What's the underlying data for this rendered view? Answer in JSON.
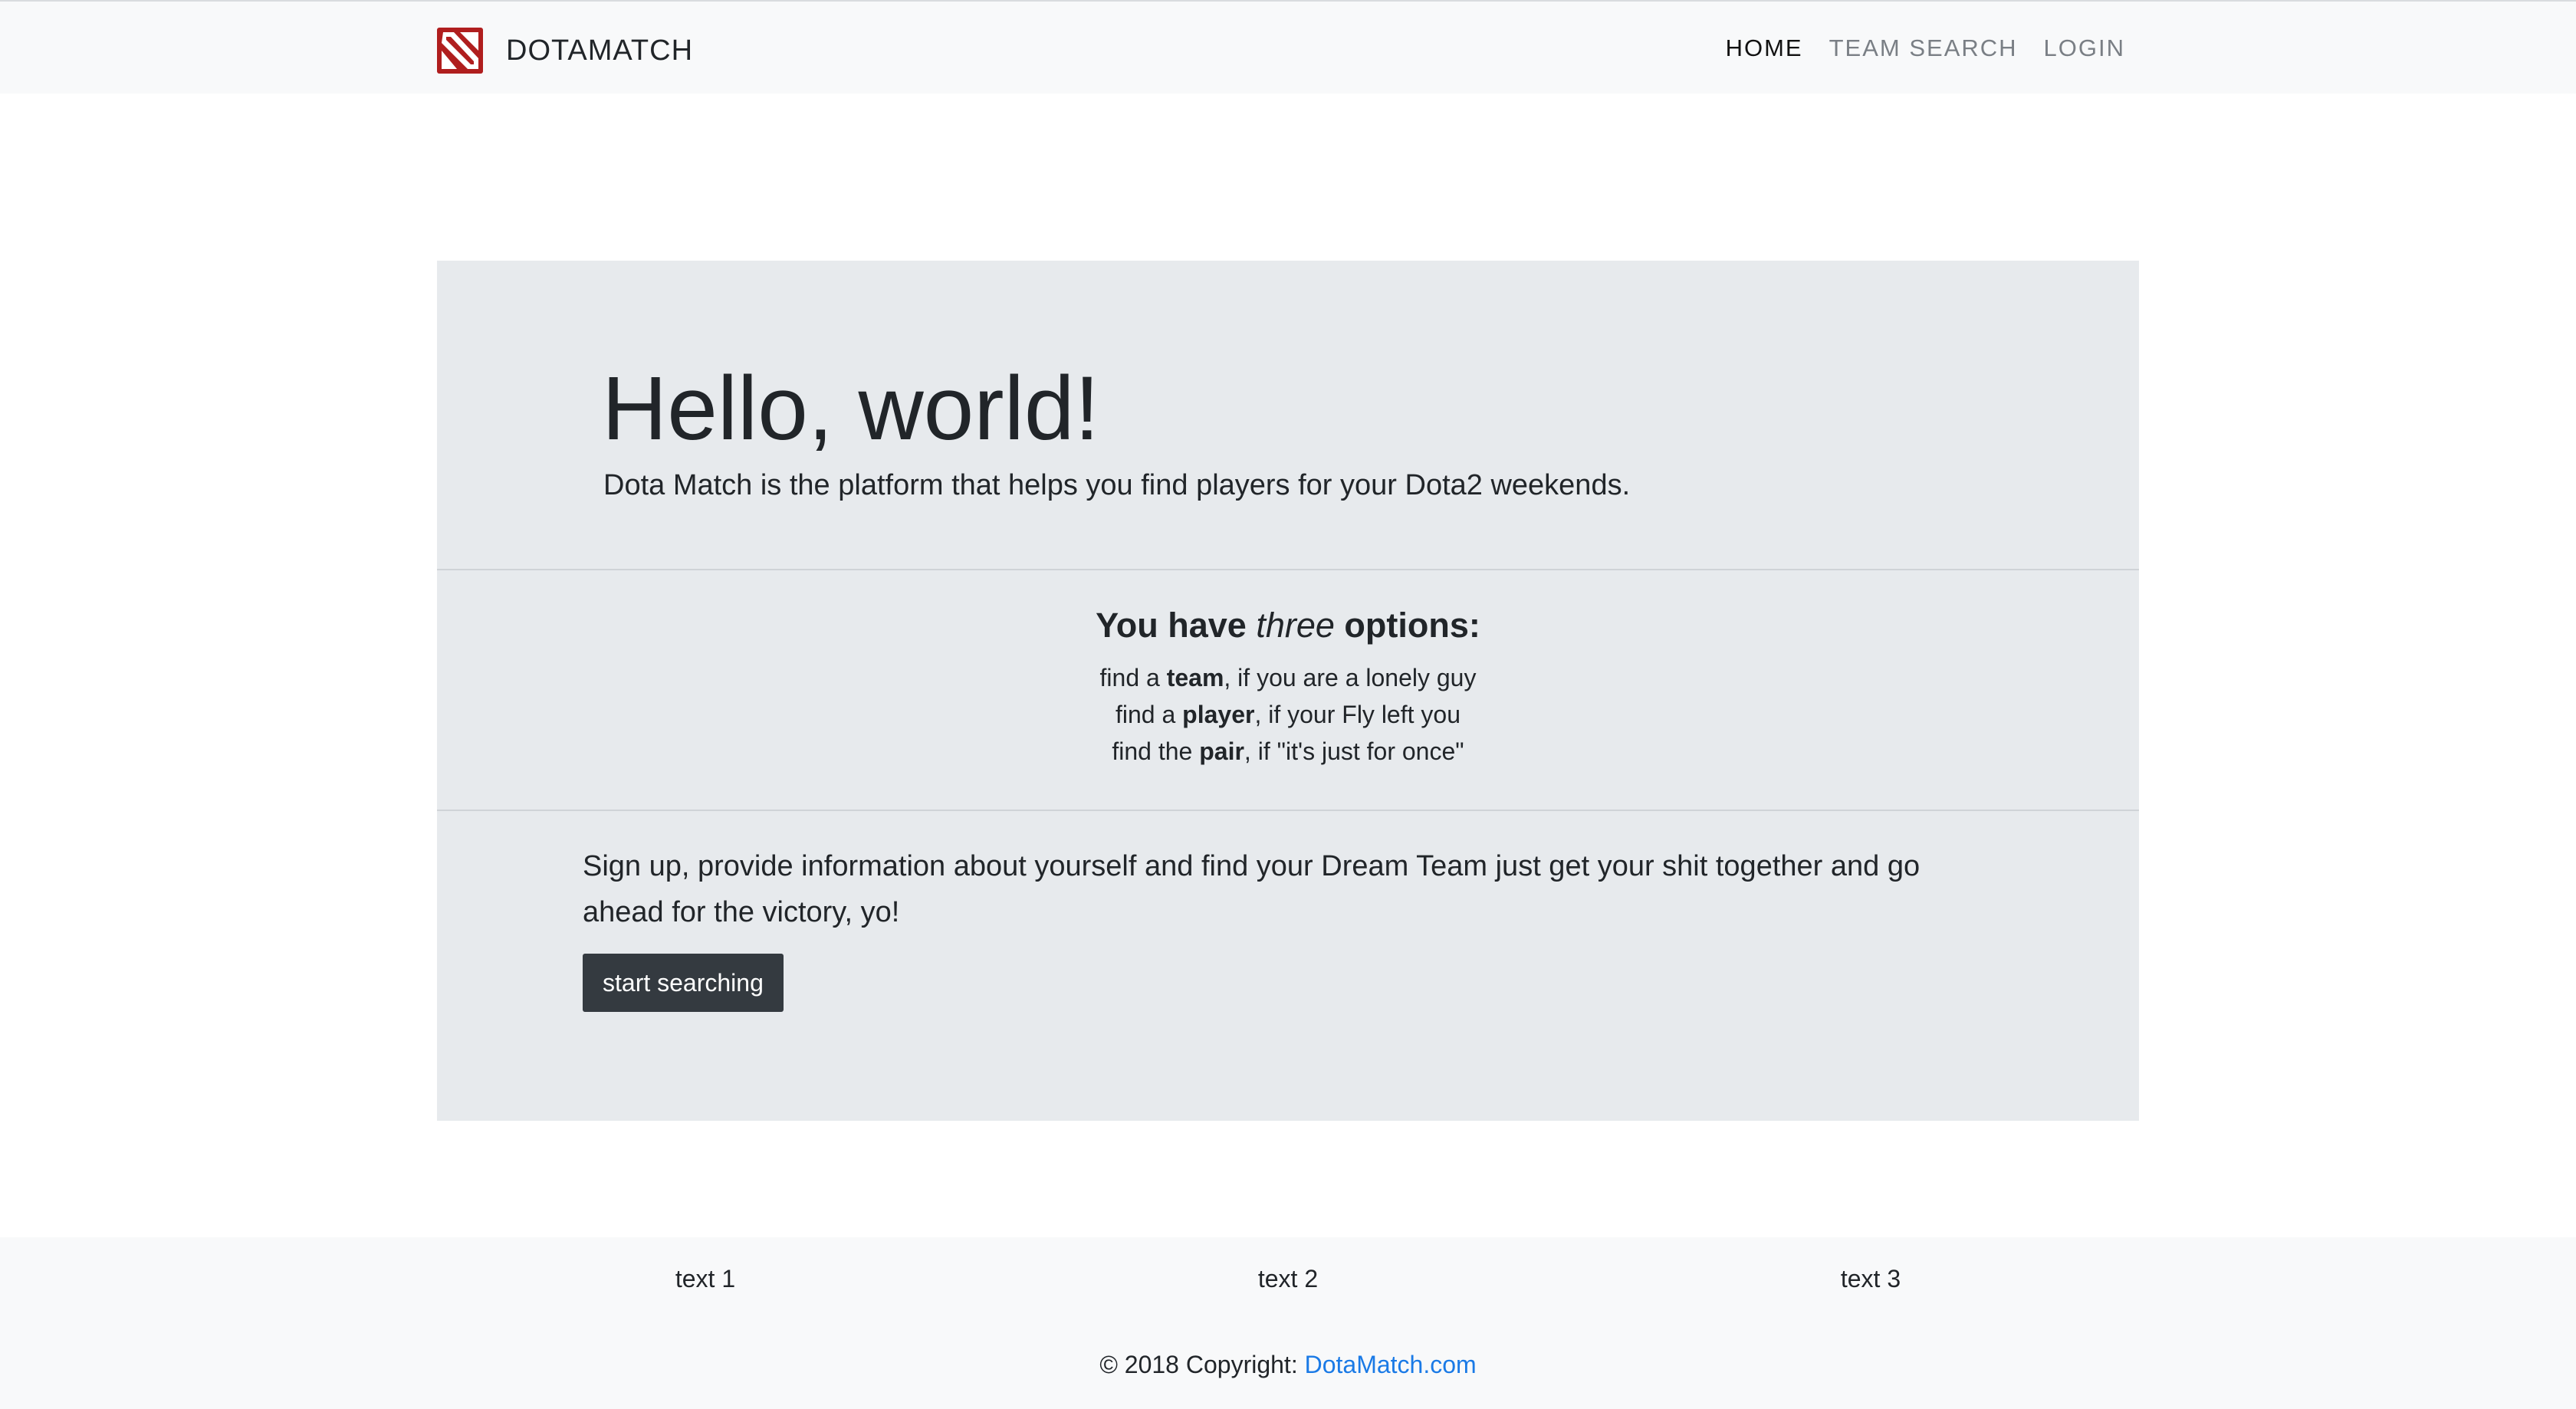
{
  "navbar": {
    "brand": "DOTAMATCH",
    "logo_icon": "dota-logo-icon",
    "links": [
      {
        "label": "HOME",
        "active": true
      },
      {
        "label": "TEAM SEARCH",
        "active": false
      },
      {
        "label": "LOGIN",
        "active": false
      }
    ]
  },
  "hero": {
    "title": "Hello, world!",
    "lead": "Dota Match is the platform that helps you find players for your Dota2 weekends."
  },
  "options": {
    "title_before": "You have ",
    "title_em": "three",
    "title_after": " options:",
    "items": [
      {
        "prefix": "find a ",
        "bold": "team",
        "suffix": ", if you are a lonely guy"
      },
      {
        "prefix": "find a ",
        "bold": "player",
        "suffix": ", if your Fly left you"
      },
      {
        "prefix": "find the ",
        "bold": "pair",
        "suffix": ", if \"it's just for once\""
      }
    ]
  },
  "signup": {
    "text": "Sign up, provide information about yourself and find your Dream Team just get your shit together and go ahead for the victory, yo!",
    "button_label": "start searching"
  },
  "footer": {
    "columns": [
      "text 1",
      "text 2",
      "text 3"
    ],
    "copyright_prefix": "© 2018 Copyright: ",
    "copyright_link": "DotaMatch.com"
  },
  "colors": {
    "navbar_bg": "#f8f9fa",
    "jumbotron_bg": "#e7eaed",
    "button_bg": "#343a40",
    "link": "#1a7ae6",
    "logo_red": "#b01e1e"
  }
}
